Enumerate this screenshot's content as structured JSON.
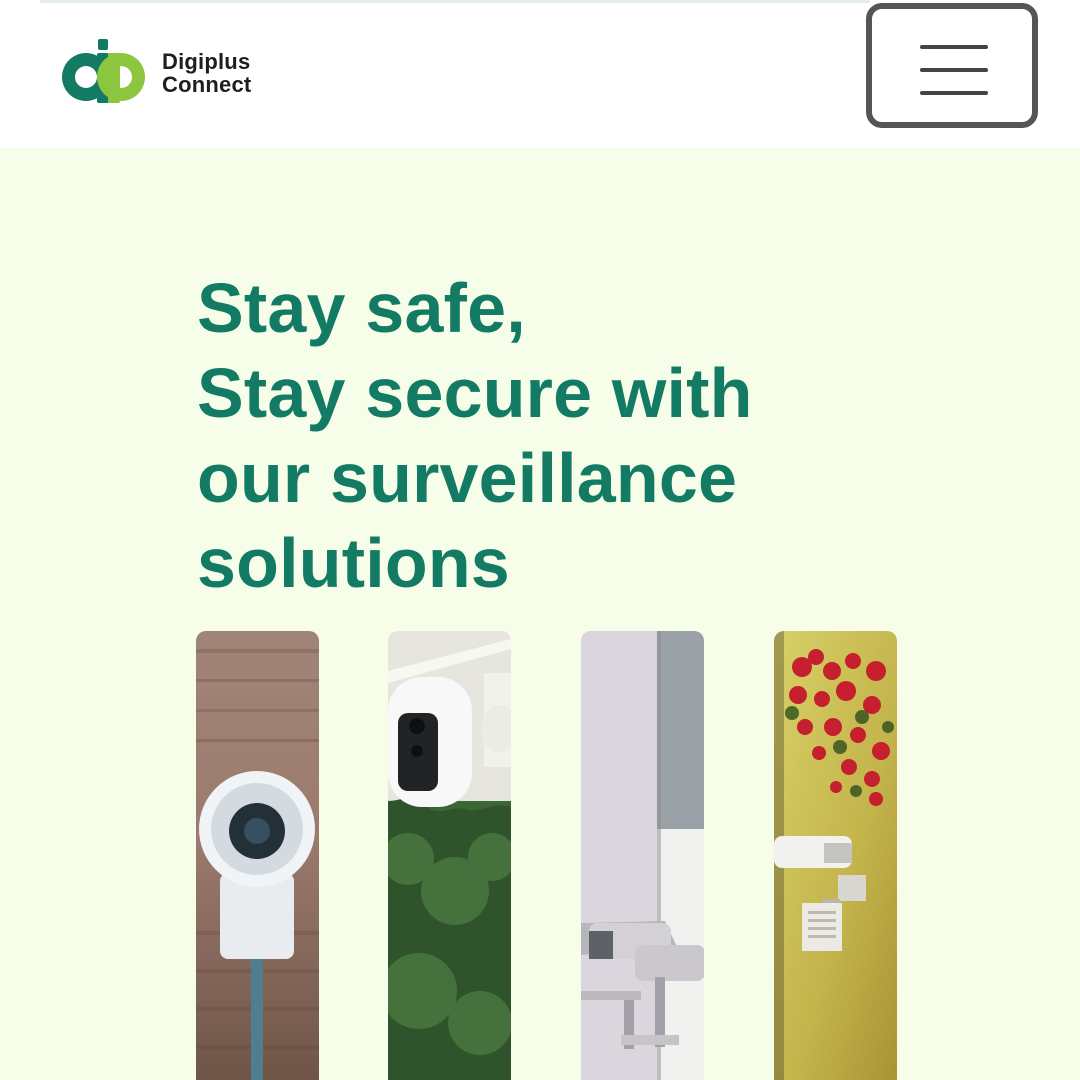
{
  "header": {
    "logo": {
      "name_line1": "Digiplus",
      "name_line2": "Connect"
    },
    "menu_icon": "hamburger-icon"
  },
  "hero": {
    "title_lines": [
      "Stay safe,",
      "Stay secure with",
      "our surveillance",
      "solutions"
    ]
  },
  "gallery": {
    "images": [
      "dome-camera-on-brick-wall",
      "white-outdoor-camera-under-eave-with-trees",
      "bullet-cameras-on-white-building-corner",
      "bullet-camera-on-yellow-wall-with-red-flowers"
    ]
  },
  "colors": {
    "brand_green": "#137a64",
    "brand_lime": "#8cc63e",
    "page_background": "#f6fde8",
    "header_background": "#ffffff",
    "menu_border": "#555555"
  }
}
